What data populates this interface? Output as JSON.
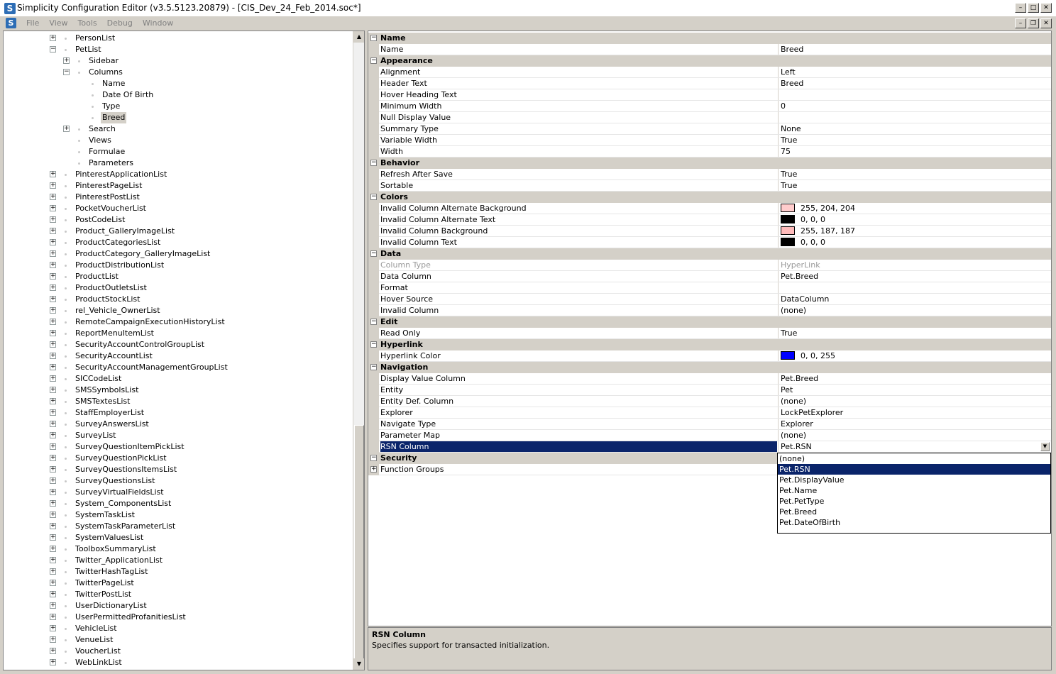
{
  "window": {
    "title": "Simplicity Configuration Editor (v3.5.5123.20879) - [CIS_Dev_24_Feb_2014.soc*]",
    "app_icon": "S"
  },
  "menu": {
    "items": [
      "File",
      "View",
      "Tools",
      "Debug",
      "Window"
    ]
  },
  "tree": {
    "items": [
      {
        "label": "PersonList",
        "level": 0,
        "expander": "+"
      },
      {
        "label": "PetList",
        "level": 0,
        "expander": "-"
      },
      {
        "label": "Sidebar",
        "level": 1,
        "expander": "+"
      },
      {
        "label": "Columns",
        "level": 1,
        "expander": "-"
      },
      {
        "label": "Name",
        "level": 2,
        "expander": ""
      },
      {
        "label": "Date Of Birth",
        "level": 2,
        "expander": ""
      },
      {
        "label": "Type",
        "level": 2,
        "expander": ""
      },
      {
        "label": "Breed",
        "level": 2,
        "expander": "",
        "selected": true
      },
      {
        "label": "Search",
        "level": 1,
        "expander": "+"
      },
      {
        "label": "Views",
        "level": 1,
        "expander": ""
      },
      {
        "label": "Formulae",
        "level": 1,
        "expander": ""
      },
      {
        "label": "Parameters",
        "level": 1,
        "expander": ""
      },
      {
        "label": "PinterestApplicationList",
        "level": 0,
        "expander": "+"
      },
      {
        "label": "PinterestPageList",
        "level": 0,
        "expander": "+"
      },
      {
        "label": "PinterestPostList",
        "level": 0,
        "expander": "+"
      },
      {
        "label": "PocketVoucherList",
        "level": 0,
        "expander": "+"
      },
      {
        "label": "PostCodeList",
        "level": 0,
        "expander": "+"
      },
      {
        "label": "Product_GalleryImageList",
        "level": 0,
        "expander": "+"
      },
      {
        "label": "ProductCategoriesList",
        "level": 0,
        "expander": "+"
      },
      {
        "label": "ProductCategory_GalleryImageList",
        "level": 0,
        "expander": "+"
      },
      {
        "label": "ProductDistributionList",
        "level": 0,
        "expander": "+"
      },
      {
        "label": "ProductList",
        "level": 0,
        "expander": "+"
      },
      {
        "label": "ProductOutletsList",
        "level": 0,
        "expander": "+"
      },
      {
        "label": "ProductStockList",
        "level": 0,
        "expander": "+"
      },
      {
        "label": "rel_Vehicle_OwnerList",
        "level": 0,
        "expander": "+"
      },
      {
        "label": "RemoteCampaignExecutionHistoryList",
        "level": 0,
        "expander": "+"
      },
      {
        "label": "ReportMenuItemList",
        "level": 0,
        "expander": "+"
      },
      {
        "label": "SecurityAccountControlGroupList",
        "level": 0,
        "expander": "+"
      },
      {
        "label": "SecurityAccountList",
        "level": 0,
        "expander": "+"
      },
      {
        "label": "SecurityAccountManagementGroupList",
        "level": 0,
        "expander": "+"
      },
      {
        "label": "SICCodeList",
        "level": 0,
        "expander": "+"
      },
      {
        "label": "SMSSymbolsList",
        "level": 0,
        "expander": "+"
      },
      {
        "label": "SMSTextesList",
        "level": 0,
        "expander": "+"
      },
      {
        "label": "StaffEmployerList",
        "level": 0,
        "expander": "+"
      },
      {
        "label": "SurveyAnswersList",
        "level": 0,
        "expander": "+"
      },
      {
        "label": "SurveyList",
        "level": 0,
        "expander": "+"
      },
      {
        "label": "SurveyQuestionItemPickList",
        "level": 0,
        "expander": "+"
      },
      {
        "label": "SurveyQuestionPickList",
        "level": 0,
        "expander": "+"
      },
      {
        "label": "SurveyQuestionsItemsList",
        "level": 0,
        "expander": "+"
      },
      {
        "label": "SurveyQuestionsList",
        "level": 0,
        "expander": "+"
      },
      {
        "label": "SurveyVirtualFieldsList",
        "level": 0,
        "expander": "+"
      },
      {
        "label": "System_ComponentsList",
        "level": 0,
        "expander": "+"
      },
      {
        "label": "SystemTaskList",
        "level": 0,
        "expander": "+"
      },
      {
        "label": "SystemTaskParameterList",
        "level": 0,
        "expander": "+"
      },
      {
        "label": "SystemValuesList",
        "level": 0,
        "expander": "+"
      },
      {
        "label": "ToolboxSummaryList",
        "level": 0,
        "expander": "+"
      },
      {
        "label": "Twitter_ApplicationList",
        "level": 0,
        "expander": "+"
      },
      {
        "label": "TwitterHashTagList",
        "level": 0,
        "expander": "+"
      },
      {
        "label": "TwitterPageList",
        "level": 0,
        "expander": "+"
      },
      {
        "label": "TwitterPostList",
        "level": 0,
        "expander": "+"
      },
      {
        "label": "UserDictionaryList",
        "level": 0,
        "expander": "+"
      },
      {
        "label": "UserPermittedProfanitiesList",
        "level": 0,
        "expander": "+"
      },
      {
        "label": "VehicleList",
        "level": 0,
        "expander": "+"
      },
      {
        "label": "VenueList",
        "level": 0,
        "expander": "+"
      },
      {
        "label": "VoucherList",
        "level": 0,
        "expander": "+"
      },
      {
        "label": "WebLinkList",
        "level": 0,
        "expander": "+"
      }
    ]
  },
  "properties": {
    "rows": [
      {
        "type": "cat",
        "label": "Name"
      },
      {
        "type": "prop",
        "name": "Name",
        "value": "Breed"
      },
      {
        "type": "cat",
        "label": "Appearance"
      },
      {
        "type": "prop",
        "name": "Alignment",
        "value": "Left"
      },
      {
        "type": "prop",
        "name": "Header Text",
        "value": "Breed"
      },
      {
        "type": "prop",
        "name": "Hover Heading Text",
        "value": ""
      },
      {
        "type": "prop",
        "name": "Minimum Width",
        "value": "0"
      },
      {
        "type": "prop",
        "name": "Null Display Value",
        "value": ""
      },
      {
        "type": "prop",
        "name": "Summary Type",
        "value": "None"
      },
      {
        "type": "prop",
        "name": "Variable Width",
        "value": "True"
      },
      {
        "type": "prop",
        "name": "Width",
        "value": "75"
      },
      {
        "type": "cat",
        "label": "Behavior"
      },
      {
        "type": "prop",
        "name": "Refresh After Save",
        "value": "True"
      },
      {
        "type": "prop",
        "name": "Sortable",
        "value": "True"
      },
      {
        "type": "cat",
        "label": "Colors"
      },
      {
        "type": "prop",
        "name": "Invalid Column Alternate Background",
        "value": "255, 204, 204",
        "swatch": "#ffcccc"
      },
      {
        "type": "prop",
        "name": "Invalid Column Alternate Text",
        "value": "0, 0, 0",
        "swatch": "#000000"
      },
      {
        "type": "prop",
        "name": "Invalid Column Background",
        "value": "255, 187, 187",
        "swatch": "#ffbbbb"
      },
      {
        "type": "prop",
        "name": "Invalid Column Text",
        "value": "0, 0, 0",
        "swatch": "#000000"
      },
      {
        "type": "cat",
        "label": "Data"
      },
      {
        "type": "prop",
        "name": "Column Type",
        "value": "HyperLink",
        "disabled": true
      },
      {
        "type": "prop",
        "name": "Data Column",
        "value": "Pet.Breed"
      },
      {
        "type": "prop",
        "name": "Format",
        "value": ""
      },
      {
        "type": "prop",
        "name": "Hover Source",
        "value": "DataColumn"
      },
      {
        "type": "prop",
        "name": "Invalid Column",
        "value": "(none)"
      },
      {
        "type": "cat",
        "label": "Edit"
      },
      {
        "type": "prop",
        "name": "Read Only",
        "value": "True"
      },
      {
        "type": "cat",
        "label": "Hyperlink"
      },
      {
        "type": "prop",
        "name": "Hyperlink Color",
        "value": "0, 0, 255",
        "swatch": "#0000ff"
      },
      {
        "type": "cat",
        "label": "Navigation"
      },
      {
        "type": "prop",
        "name": "Display Value Column",
        "value": "Pet.Breed"
      },
      {
        "type": "prop",
        "name": "Entity",
        "value": "Pet"
      },
      {
        "type": "prop",
        "name": "Entity Def. Column",
        "value": "(none)"
      },
      {
        "type": "prop",
        "name": "Explorer",
        "value": "LockPetExplorer"
      },
      {
        "type": "prop",
        "name": "Navigate Type",
        "value": "Explorer"
      },
      {
        "type": "prop",
        "name": "Parameter Map",
        "value": "(none)"
      },
      {
        "type": "prop",
        "name": "RSN Column",
        "value": "Pet.RSN",
        "selected": true,
        "dropdown": true
      },
      {
        "type": "cat",
        "label": "Security"
      },
      {
        "type": "prop",
        "name": "Function Groups",
        "value": "",
        "expander": "+"
      }
    ]
  },
  "dropdown": {
    "options": [
      "(none)",
      "Pet.RSN",
      "Pet.DisplayValue",
      "Pet.Name",
      "Pet.PetType",
      "Pet.Breed",
      "Pet.DateOfBirth"
    ],
    "selected_index": 1
  },
  "help": {
    "title": "RSN Column",
    "description": "Specifies support for transacted initialization."
  },
  "colors": {
    "selection": "#0a246a",
    "chrome": "#d4d0c8"
  }
}
